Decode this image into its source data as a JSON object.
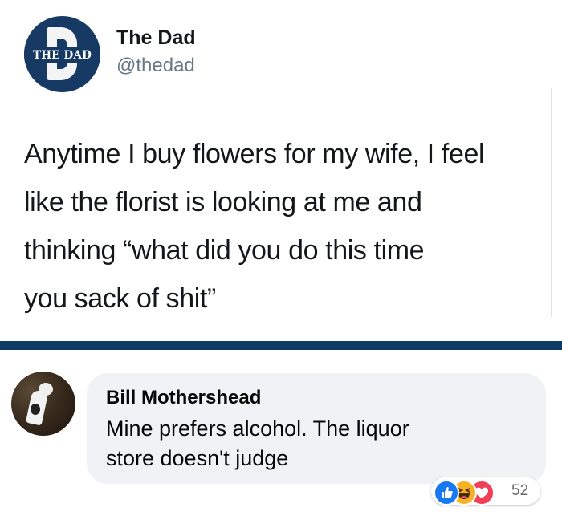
{
  "tweet": {
    "avatar_text": "THE DAD",
    "display_name": "The Dad",
    "handle": "@thedad",
    "lines": [
      "Anytime I buy flowers for my wife, I feel",
      "like the florist is looking at me and",
      "thinking “what did you do this time",
      "you sack of shit”"
    ]
  },
  "comment": {
    "author": "Bill Mothershead",
    "lines": [
      "Mine prefers alcohol.  The liquor",
      "store doesn't judge"
    ],
    "reactions": {
      "icons": [
        "like-icon",
        "haha-icon",
        "love-icon"
      ],
      "count": "52"
    }
  },
  "colors": {
    "brand_navy": "#163a63",
    "divider": "#0d3b64",
    "like": "#1877f2",
    "haha": "#f7b125",
    "love": "#f33e58",
    "bubble": "#f0f2f5"
  }
}
